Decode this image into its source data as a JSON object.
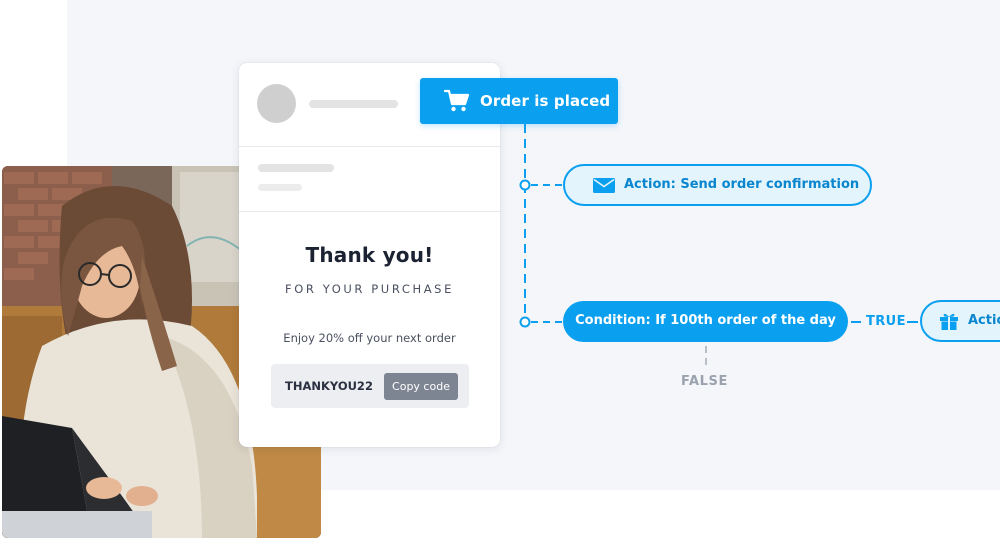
{
  "colors": {
    "accent": "#0ba0ef",
    "accent_light": "#e3f4fd",
    "accent_text": "#0a86cf",
    "muted": "#9aa2ae",
    "background_panel": "#f4f6fa",
    "card_title": "#1b2232",
    "copy_button": "#7d8592"
  },
  "photo": {
    "subject": "person-using-laptop"
  },
  "email_card": {
    "avatar_icon": "avatar-placeholder",
    "thanks_title": "Thank you!",
    "thanks_subtitle": "FOR YOUR PURCHASE",
    "offer_text": "Enjoy 20% off your next order",
    "coupon_code": "THANKYOU22",
    "copy_button_label": "Copy code"
  },
  "flow": {
    "trigger": {
      "icon": "shopping-cart-icon",
      "label": "Order is placed"
    },
    "action": {
      "icon": "envelope-icon",
      "label": "Action: Send order confirmation"
    },
    "condition": {
      "label": "Condition: If 100th order of the day"
    },
    "true_label": "TRUE",
    "false_label": "FALSE",
    "true_action": {
      "icon": "gift-icon",
      "label": "Action"
    }
  }
}
